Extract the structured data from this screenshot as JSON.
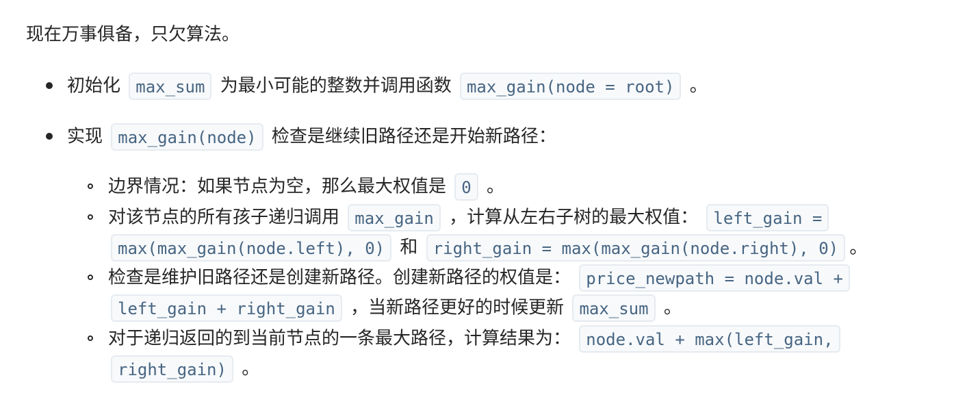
{
  "intro": "现在万事俱备，只欠算法。",
  "bullet1": {
    "t1": "初始化",
    "c1": "max_sum",
    "t2": "为最小可能的整数并调用函数",
    "c2": "max_gain(node = root)",
    "t3": "。"
  },
  "bullet2": {
    "t1": "实现",
    "c1": "max_gain(node)",
    "t2": "检查是继续旧路径还是开始新路径："
  },
  "sub1": {
    "t1": "边界情况：如果节点为空，那么最大权值是",
    "c1": "0",
    "t2": "。"
  },
  "sub2": {
    "t1": "对该节点的所有孩子递归调用",
    "c1": "max_gain",
    "t2": "，计算从左右子树的最大权值：",
    "c2": "left_gain =",
    "c3": "max(max_gain(node.left), 0)",
    "t3": "和",
    "c4": "right_gain = max(max_gain(node.right), 0)",
    "t4": "。"
  },
  "sub3": {
    "t1": "检查是维护旧路径还是创建新路径。创建新路径的权值是：",
    "c1": "price_newpath = node.val +",
    "c2": "left_gain + right_gain",
    "t2": "，当新路径更好的时候更新",
    "c3": "max_sum",
    "t3": "。"
  },
  "sub4": {
    "t1": "对于递归返回的到当前节点的一条最大路径，计算结果为：",
    "c1": "node.val + max(left_gain,",
    "c2": "right_gain)",
    "t2": "。"
  }
}
